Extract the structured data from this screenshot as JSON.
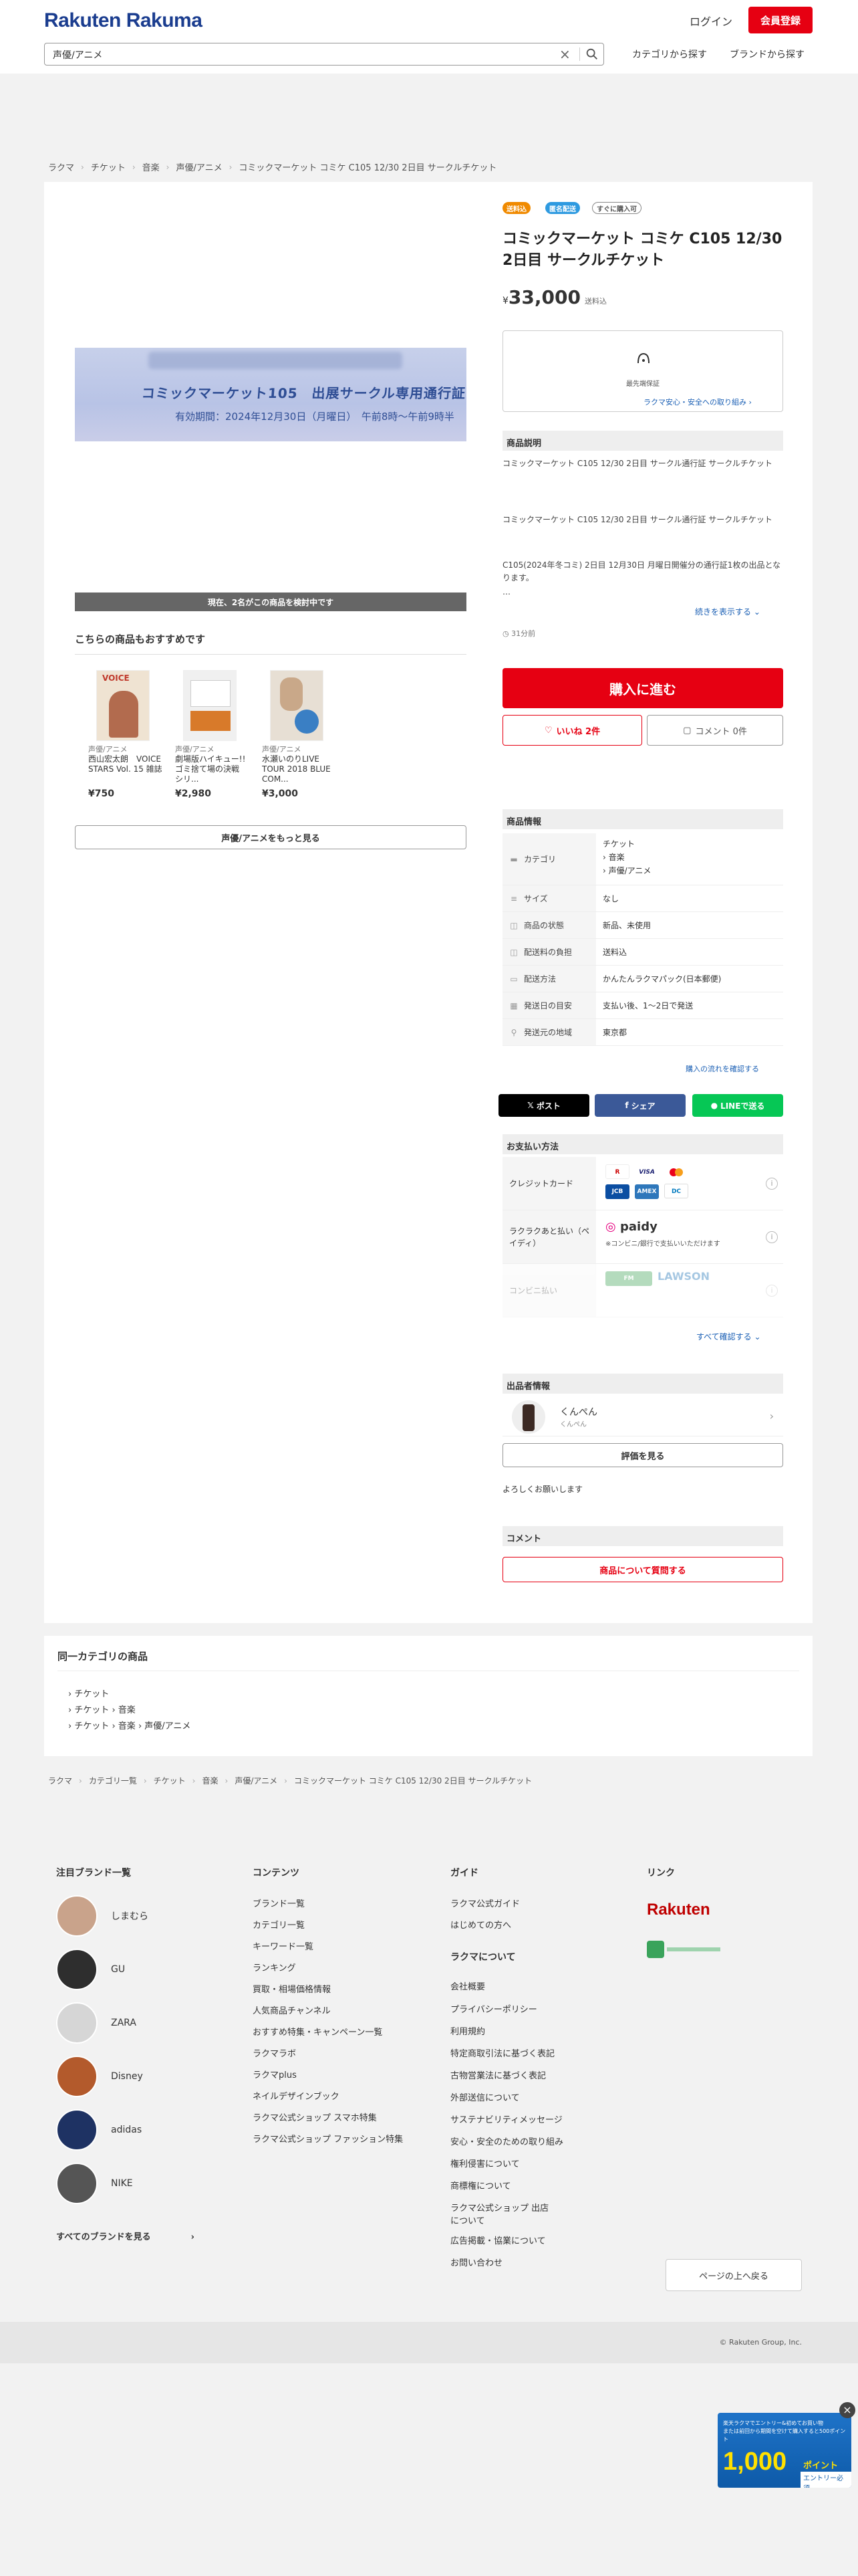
{
  "header": {
    "logo": "Rakuten Rakuma",
    "login": "ログイン",
    "register": "会員登録",
    "search_value": "声優/アニメ",
    "nav_category": "カテゴリから探す",
    "nav_brand": "ブランドから探す"
  },
  "breadcrumb_top": [
    "ラクマ",
    "チケット",
    "音楽",
    "声優/アニメ",
    "コミックマーケット コミケ C105 12/30 2日目 サークルチケット"
  ],
  "product": {
    "image_text": "コミックマーケット105　出展サークル専用通行証",
    "image_sub": "有効期間：2024年12月30日（月曜日）　午前8時〜午前9時半",
    "viewers": "現在、2名がこの商品を検討中です",
    "badges": [
      "送料込",
      "匿名配送",
      "すぐに購入可"
    ],
    "title": "コミックマーケット コミケ C105 12/30 2日目 サークルチケット",
    "price_prefix": "¥",
    "price": "33,000",
    "shipping_note": "送料込",
    "safe_label": "最先端保証",
    "safe_link": "ラクマ安心・安全への取り組み",
    "desc_heading": "商品説明",
    "desc_1": "コミックマーケット C105 12/30 2日目 サークル通行証 サークルチケット",
    "desc_2": "コミックマーケット C105 12/30 2日目 サークル通行証 サークルチケット",
    "desc_3": "C105(2024年冬コミ) 2日目 12月30日 月曜日開催分の通行証1枚の出品となります。",
    "desc_ellipsis": "…",
    "read_more": "続きを表示する",
    "time_ago": "31分前",
    "buy": "購入に進む",
    "like": "いいね 2件",
    "comment": "コメント 0件"
  },
  "recommend": {
    "title": "こちらの商品もおすすめです",
    "items": [
      {
        "category": "声優/アニメ",
        "name": "西山宏太朗　VOICE STARS Vol. 15 雑誌",
        "price": "¥750"
      },
      {
        "category": "声優/アニメ",
        "name": "劇場版ハイキュー!! ゴミ捨て場の決戦　シリ...",
        "price": "¥2,980"
      },
      {
        "category": "声優/アニメ",
        "name": "水瀬いのりLIVE TOUR 2018 BLUE COM...",
        "price": "¥3,000"
      }
    ],
    "more": "声優/アニメをもっと見る"
  },
  "info": {
    "heading": "商品情報",
    "category_label": "カテゴリ",
    "category_values": [
      "チケット",
      "› 音楽",
      "› 声優/アニメ"
    ],
    "rows": [
      {
        "label": "サイズ",
        "value": "なし"
      },
      {
        "label": "商品の状態",
        "value": "新品、未使用"
      },
      {
        "label": "配送料の負担",
        "value": "送料込"
      },
      {
        "label": "配送方法",
        "value": "かんたんラクマパック(日本郵便)"
      },
      {
        "label": "発送日の目安",
        "value": "支払い後、1〜2日で発送"
      },
      {
        "label": "発送元の地域",
        "value": "東京都"
      }
    ],
    "flow_link": "購入の流れを確認する"
  },
  "share": {
    "x": "ポスト",
    "facebook": "シェア",
    "line": "LINEで送る"
  },
  "payment": {
    "heading": "お支払い方法",
    "credit": "クレジットカード",
    "later": "ラクラクあと払い（ペイディ）",
    "paidy": "paidy",
    "paidy_note": "※コンビニ/銀行で支払いいただけます",
    "conveni": "コンビニ払い",
    "conveni_logo": "LAWSON",
    "more": "すべて確認する"
  },
  "seller": {
    "heading": "出品者情報",
    "name": "くんぺん",
    "sub": "くんぺん",
    "review": "評価を見る",
    "message": "よろしくお願いします"
  },
  "comment_section": {
    "heading": "コメント",
    "ask": "商品について質問する"
  },
  "same_category": {
    "title": "同一カテゴリの商品",
    "items": [
      "チケット",
      "チケット › 音楽",
      "チケット › 音楽 › 声優/アニメ"
    ]
  },
  "breadcrumb_bottom": [
    "ラクマ",
    "カテゴリ一覧",
    "チケット",
    "音楽",
    "声優/アニメ",
    "コミックマーケット コミケ C105 12/30 2日目 サークルチケット"
  ],
  "footer": {
    "brands_title": "注目ブランド一覧",
    "brands": [
      "しまむら",
      "GU",
      "ZARA",
      "Disney",
      "adidas",
      "NIKE"
    ],
    "all_brands": "すべてのブランドを見る",
    "contents_title": "コンテンツ",
    "contents": [
      "ブランド一覧",
      "カテゴリ一覧",
      "キーワード一覧",
      "ランキング",
      "買取・相場価格情報",
      "人気商品チャンネル",
      "おすすめ特集・キャンペーン一覧",
      "ラクマラボ",
      "ラクマplus",
      "ネイルデザインブック",
      "ラクマ公式ショップ スマホ特集",
      "ラクマ公式ショップ ファッション特集"
    ],
    "guide_title": "ガイド",
    "guide": [
      "ラクマ公式ガイド",
      "はじめての方へ"
    ],
    "about_title": "ラクマについて",
    "about": [
      "会社概要",
      "プライバシーポリシー",
      "利用規約",
      "特定商取引法に基づく表記",
      "古物営業法に基づく表記",
      "外部送信について",
      "サステナビリティメッセージ",
      "安心・安全のための取り組み",
      "権利侵害について",
      "商標権について",
      "ラクマ公式ショップ 出店について",
      "広告掲載・協業について",
      "お問い合わせ"
    ],
    "links_title": "リンク",
    "link_rakuten": "Rakuten",
    "page_top": "ページの上へ戻る",
    "copyright": "© Rakuten Group, Inc."
  },
  "banner": {
    "line1": "楽天ラクマでエントリー&初めてお買い物",
    "line2": "または前回から期間を空けて購入すると500ポイント",
    "amount": "1,000",
    "unit": "ポイント",
    "cta": "エントリー必須"
  },
  "colors": {
    "accent": "#e60012",
    "link": "#1a5fb4",
    "brand": "#1b3d8f"
  }
}
